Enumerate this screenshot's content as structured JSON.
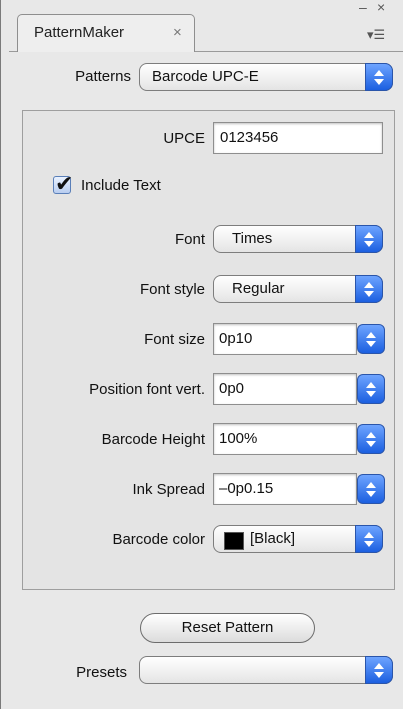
{
  "tab": {
    "title": "PatternMaker",
    "close_glyph": "×"
  },
  "window_controls": {
    "minimize_glyph": "–",
    "close_glyph": "×",
    "menu_glyph": "▾☰"
  },
  "patterns": {
    "label": "Patterns",
    "value": "Barcode UPC-E"
  },
  "upce": {
    "label": "UPCE",
    "value": "0123456"
  },
  "include_text": {
    "label": "Include Text",
    "checked": true
  },
  "font": {
    "label": "Font",
    "value": "Times"
  },
  "font_style": {
    "label": "Font style",
    "value": "Regular"
  },
  "font_size": {
    "label": "Font size",
    "value": "0p10"
  },
  "position_font_vert": {
    "label": "Position font vert.",
    "value": "0p0"
  },
  "barcode_height": {
    "label": "Barcode Height",
    "value": "100%"
  },
  "ink_spread": {
    "label": "Ink Spread",
    "value": "–0p0.15"
  },
  "barcode_color": {
    "label": "Barcode color",
    "value": "[Black]",
    "swatch_color": "#000000"
  },
  "reset_button": {
    "label": "Reset Pattern"
  },
  "presets": {
    "label": "Presets",
    "value": ""
  }
}
